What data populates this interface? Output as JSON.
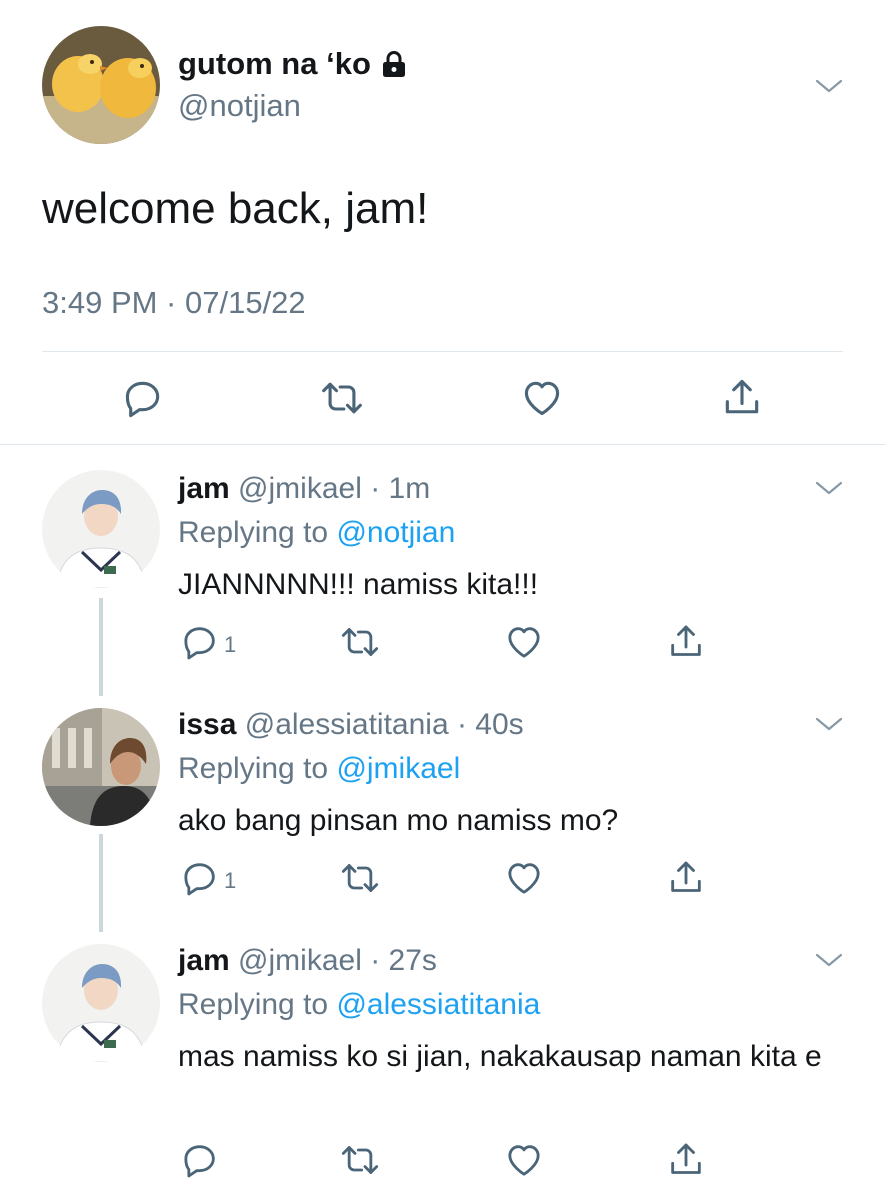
{
  "main_tweet": {
    "display_name": "gutom na ‘ko",
    "handle": "@notjian",
    "text": "welcome back, jam!",
    "timestamp": "3:49 PM · 07/15/22"
  },
  "replies": [
    {
      "display_name": "jam",
      "handle": "@jmikael",
      "time": "· 1m",
      "replying_label": "Replying to",
      "replying_to": "@notjian",
      "text": "JIANNNNN!!! namiss kita!!!",
      "reply_count": "1"
    },
    {
      "display_name": "issa",
      "handle": "@alessiatitania",
      "time": "· 40s",
      "replying_label": "Replying to",
      "replying_to": "@jmikael",
      "text": "ako bang pinsan mo namiss mo?",
      "reply_count": "1"
    },
    {
      "display_name": "jam",
      "handle": "@jmikael",
      "time": "· 27s",
      "replying_label": "Replying to",
      "replying_to": "@alessiatitania",
      "text": "mas namiss ko si jian, nakakausap naman kita e",
      "reply_count": ""
    }
  ],
  "colors": {
    "link": "#1da1f2",
    "secondary": "#657786",
    "icon": "#4a6478",
    "divider": "#e1e8ed"
  }
}
